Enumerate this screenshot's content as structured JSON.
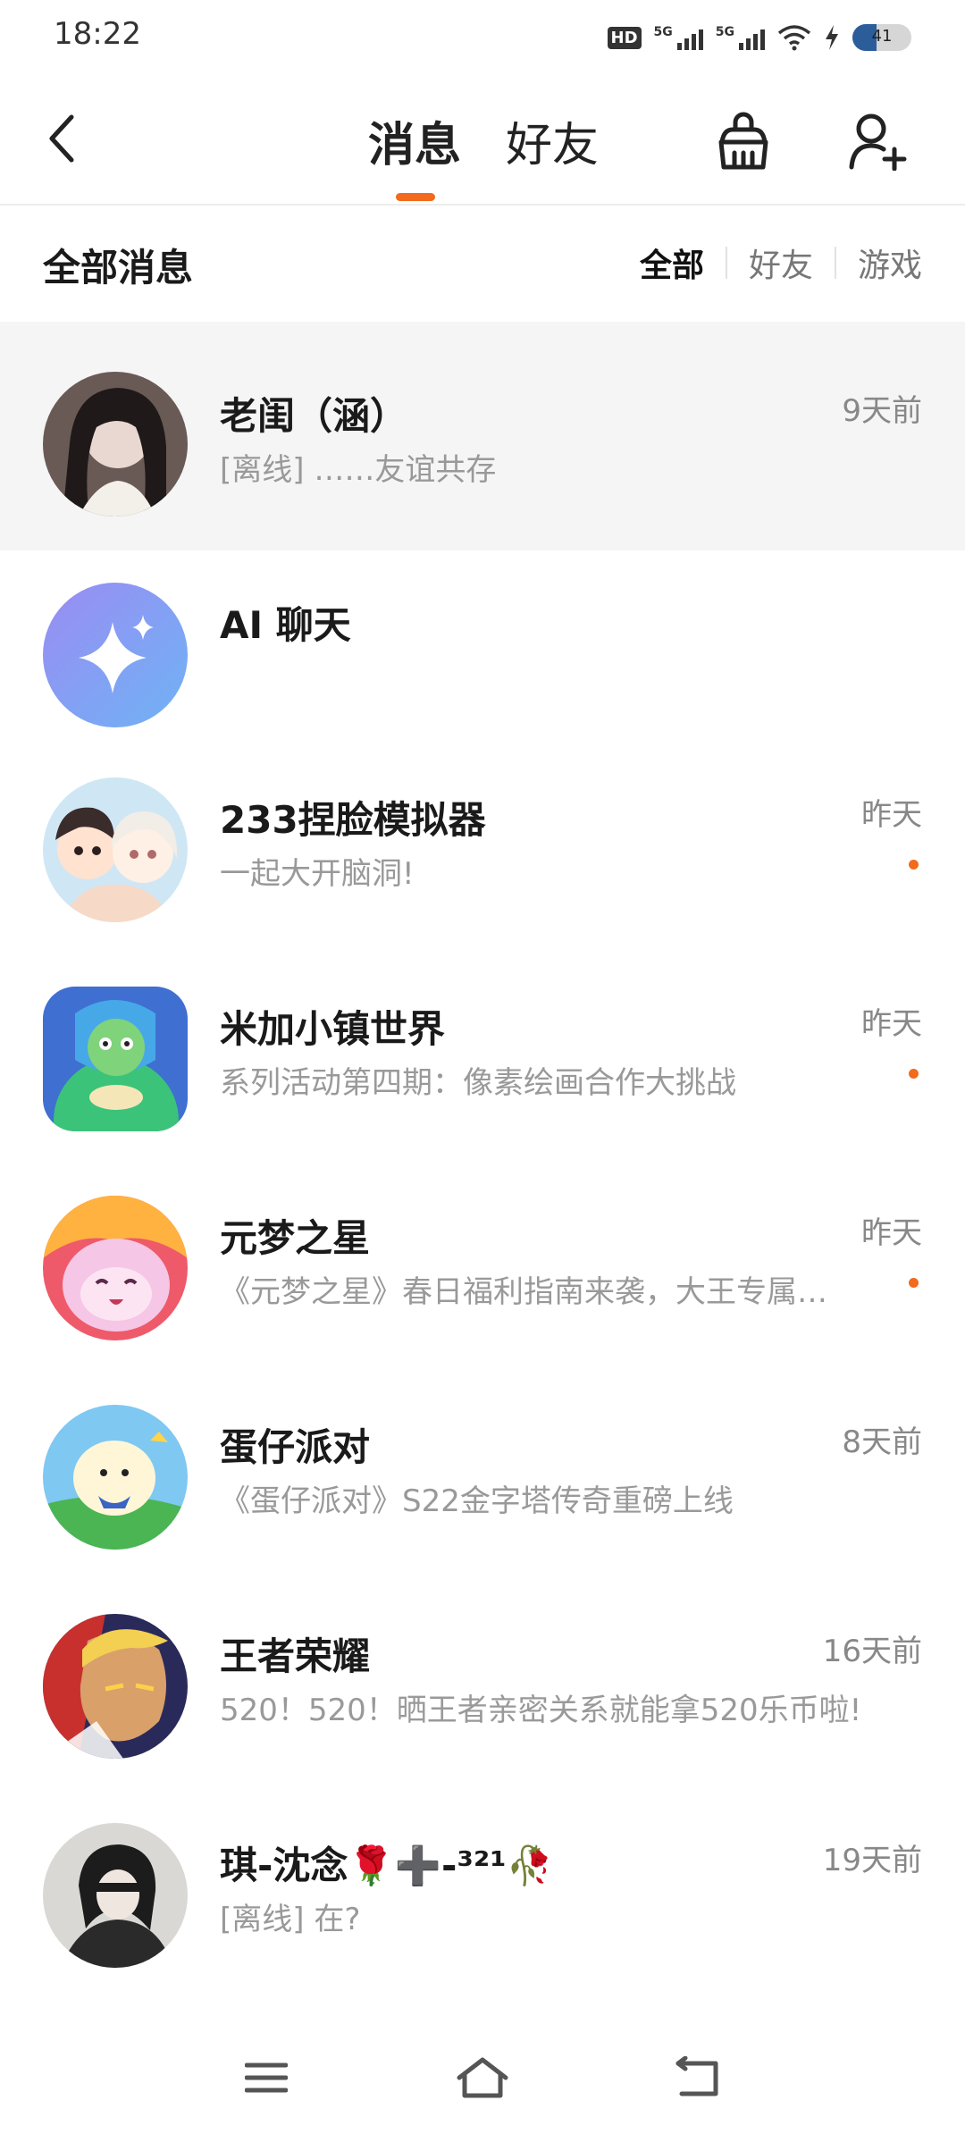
{
  "status_bar": {
    "time": "18:22",
    "hd_label": "HD",
    "net1": "5G",
    "net2": "5G",
    "battery_level": "41",
    "battery_fraction": 0.41
  },
  "header": {
    "tabs": [
      {
        "label": "消息",
        "active": true
      },
      {
        "label": "好友",
        "active": false
      }
    ]
  },
  "section": {
    "title": "全部消息",
    "filters": [
      {
        "label": "全部",
        "active": true
      },
      {
        "label": "好友",
        "active": false
      },
      {
        "label": "游戏",
        "active": false
      }
    ]
  },
  "messages": [
    {
      "name": "老闺（涵）",
      "time": "9天前",
      "preview": "[离线] ……友谊共存",
      "unread": false
    },
    {
      "name": "AI 聊天",
      "time": "",
      "preview": "",
      "unread": false
    },
    {
      "name": "233捏脸模拟器",
      "time": "昨天",
      "preview": "一起大开脑洞!",
      "unread": true
    },
    {
      "name": "米加小镇世界",
      "time": "昨天",
      "preview": "系列活动第四期：像素绘画合作大挑战",
      "unread": true
    },
    {
      "name": "元梦之星",
      "time": "昨天",
      "preview": "《元梦之星》春日福利指南来袭，大王专属…",
      "unread": true
    },
    {
      "name": "蛋仔派对",
      "time": "8天前",
      "preview": "《蛋仔派对》S22金字塔传奇重磅上线",
      "unread": false
    },
    {
      "name": "王者荣耀",
      "time": "16天前",
      "preview": "520！520！晒王者亲密关系就能拿520乐币啦!",
      "unread": false
    },
    {
      "name": "琪-沈念🌹➕-³²¹🥀",
      "time": "19天前",
      "preview": "[离线] 在?",
      "unread": false
    }
  ],
  "colors": {
    "accent": "#f26a1b",
    "highlight_bg": "#f5f5f5"
  },
  "icons": {
    "back": "chevron-left-icon",
    "clean": "broom-icon",
    "add_friend": "add-user-icon",
    "nav_menu": "menu-icon",
    "nav_home": "home-icon",
    "nav_back": "back-icon"
  }
}
